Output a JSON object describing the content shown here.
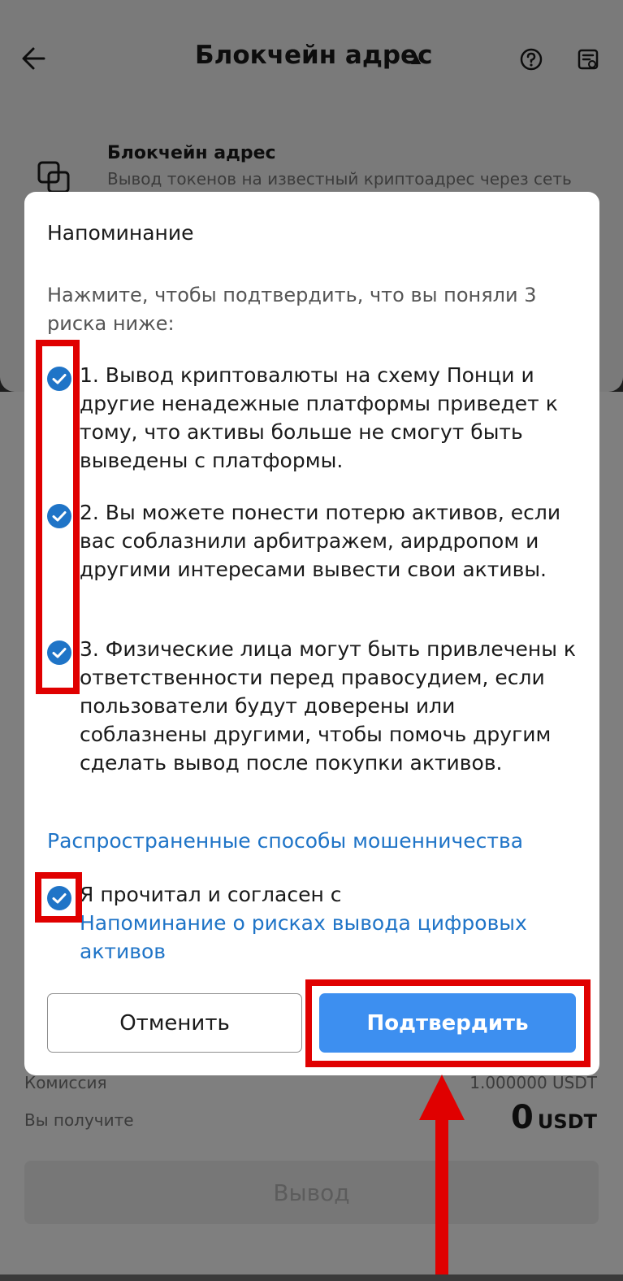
{
  "background": {
    "header": {
      "title": "Блокчейн адрес"
    },
    "option": {
      "title": "Блокчейн адрес",
      "description": "Вывод токенов на известный криптоадрес через сеть"
    },
    "fee": {
      "label": "Комиссия",
      "value": "1.000000 USDT"
    },
    "receive": {
      "label": "Вы получите",
      "amount": "0",
      "unit": "USDT"
    },
    "withdraw_button": "Вывод"
  },
  "dialog": {
    "title": "Напоминание",
    "intro": "Нажмите, чтобы подтвердить, что вы поняли 3 риска ниже:",
    "risks": [
      {
        "text": "1. Вывод криптовалюты на схему Понци и другие ненадежные платформы приведет к тому, что активы больше не смогут быть выведены с платформы.",
        "checked": true
      },
      {
        "text": "2. Вы можете понести потерю активов, если вас соблазнили арбитражем, аирдропом и другими интересами вывести свои активы.",
        "checked": true
      },
      {
        "text": "3. Физические лица могут быть привлечены к ответственности перед правосудием, если пользователи будут доверены или соблазнены другими, чтобы помочь другим сделать вывод после покупки активов.",
        "checked": true
      }
    ],
    "fraud_link": "Распространенные способы мошенничества",
    "agree_text": "Я прочитал и согласен с",
    "agree_link": "Напоминание о рисках вывода цифровых активов",
    "agree_checked": true,
    "cancel_label": "Отменить",
    "confirm_label": "Подтвердить"
  },
  "colors": {
    "accent": "#3d8ff0",
    "link": "#1f74c7",
    "highlight": "#e00000"
  }
}
